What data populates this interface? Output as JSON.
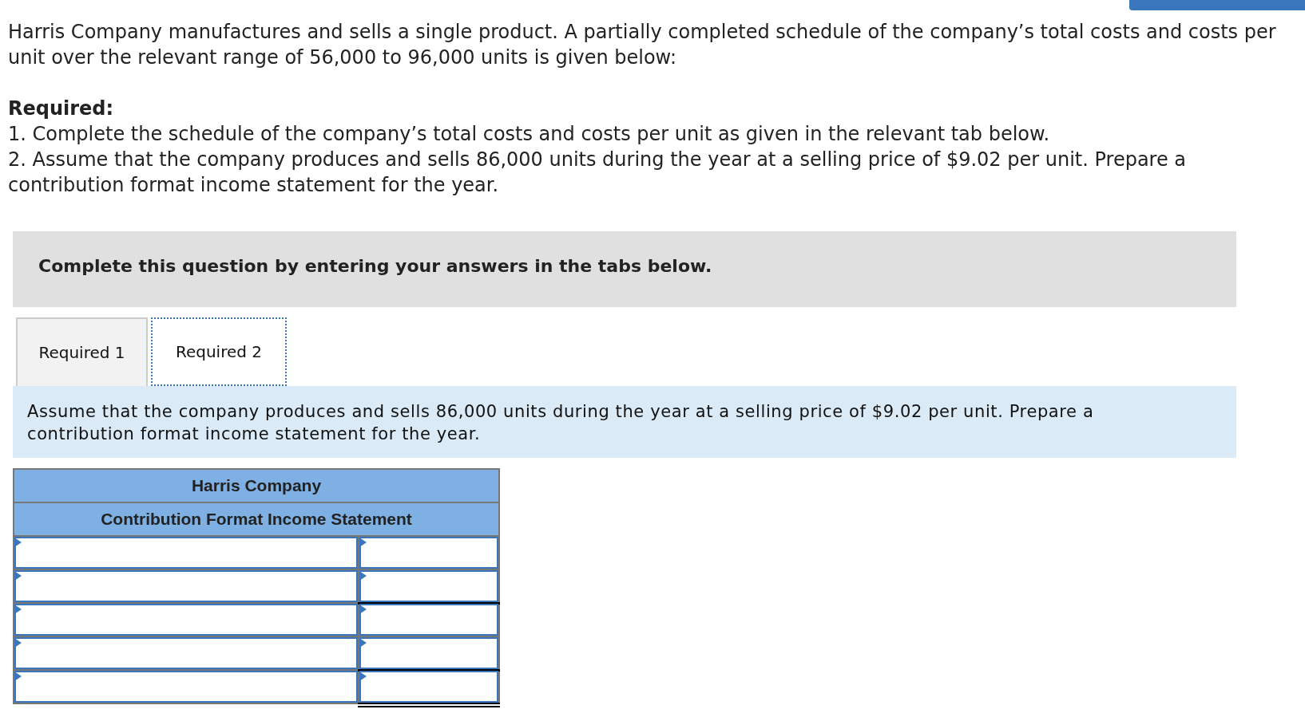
{
  "top_button": {
    "visible": true
  },
  "intro": "Harris Company manufactures and sells a single product. A partially completed schedule of the company’s total costs and costs per unit over the relevant range of 56,000 to 96,000 units is given below:",
  "required": {
    "heading": "Required:",
    "items": [
      "1. Complete the schedule of the company’s total costs and costs per unit as given in the relevant tab below.",
      "2. Assume that the company produces and sells 86,000 units during the year at a selling price of $9.02 per unit. Prepare a contribution format income statement for the year."
    ]
  },
  "instruction_panel": "Complete this question by entering your answers in the tabs below.",
  "tabs": [
    {
      "label": "Required 1",
      "selected": false
    },
    {
      "label": "Required 2",
      "selected": true
    }
  ],
  "tab_prompt": "Assume that the company produces and sells 86,000 units during the year at a selling price of $9.02 per unit. Prepare a contribution format income statement for the year.",
  "statement": {
    "title": "Harris Company",
    "subtitle": "Contribution Format Income Statement",
    "rows": [
      {
        "kind": "input",
        "total_rule": false
      },
      {
        "kind": "input",
        "total_rule": true,
        "double_rule": false
      },
      {
        "kind": "input",
        "total_rule": false
      },
      {
        "kind": "input",
        "total_rule": true,
        "double_rule": false
      },
      {
        "kind": "input",
        "total_rule": true,
        "double_rule": true
      }
    ]
  }
}
